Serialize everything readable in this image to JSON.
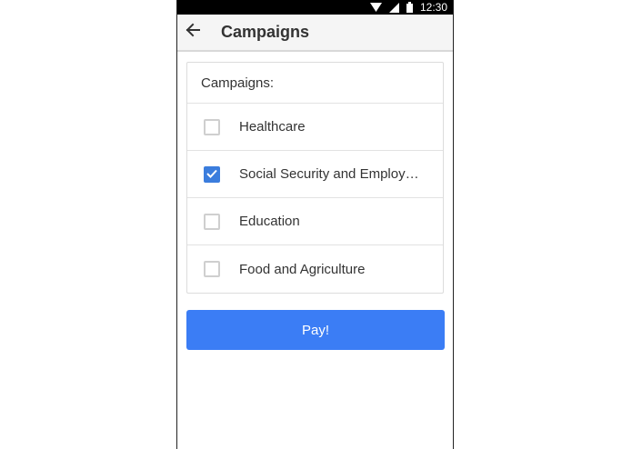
{
  "status_bar": {
    "time": "12:30",
    "icons": [
      "wifi-icon",
      "signal-icon",
      "battery-icon"
    ]
  },
  "app_bar": {
    "back_icon": "arrow-left-icon",
    "title": "Campaigns"
  },
  "campaigns": {
    "header": "Campaigns:",
    "items": [
      {
        "label": "Healthcare",
        "checked": false
      },
      {
        "label": "Social Security and Employ…",
        "checked": true
      },
      {
        "label": "Education",
        "checked": false
      },
      {
        "label": "Food and Agriculture",
        "checked": false
      }
    ]
  },
  "pay_button": {
    "label": "Pay!"
  },
  "colors": {
    "accent": "#3b7df5",
    "checkbox_checked": "#3b7ddd",
    "status_bar": "#000000"
  }
}
